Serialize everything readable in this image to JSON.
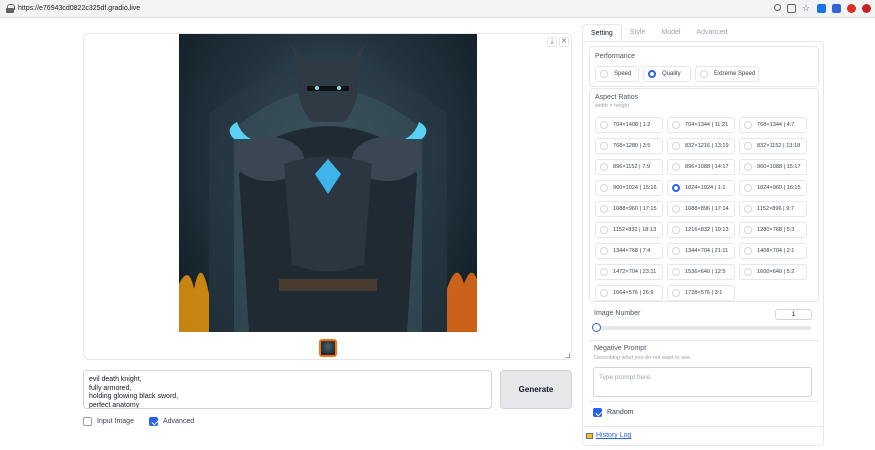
{
  "browser": {
    "url": "https://e76943cd0822c325df.gradio.live"
  },
  "gallery": {
    "image_alt": "evil death knight render",
    "selected_thumb": 0
  },
  "prompt": {
    "text": "evil death knight,\nfully armored,\nholding glowing black sword,\nperfect anatomy"
  },
  "generate_label": "Generate",
  "options": {
    "input_image_label": "Input Image",
    "input_image_checked": false,
    "advanced_label": "Advanced",
    "advanced_checked": true
  },
  "tabs": [
    "Setting",
    "Style",
    "Model",
    "Advanced"
  ],
  "performance": {
    "label": "Performance",
    "options": [
      "Speed",
      "Quality",
      "Extreme Speed"
    ],
    "selected": "Quality"
  },
  "aspect": {
    "label": "Aspect Ratios",
    "sub": "width × height",
    "options": [
      "704×1408 | 1:2",
      "704×1344 | 11:21",
      "768×1344 | 4:7",
      "768×1280 | 3:5",
      "832×1216 | 13:19",
      "832×1152 | 13:18",
      "896×1152 | 7:9",
      "896×1088 | 14:17",
      "960×1088 | 15:17",
      "960×1024 | 15:16",
      "1024×1024 | 1:1",
      "1024×960 | 16:15",
      "1088×960 | 17:15",
      "1088×896 | 17:14",
      "1152×896 | 9:7",
      "1152×832 | 18:13",
      "1216×832 | 19:13",
      "1280×768 | 5:3",
      "1344×768 | 7:4",
      "1344×704 | 21:11",
      "1408×704 | 2:1",
      "1472×704 | 23:11",
      "1536×640 | 12:5",
      "1600×640 | 5:2",
      "1664×576 | 26:9",
      "1728×576 | 3:1"
    ],
    "selected": "1024×1024 | 1:1"
  },
  "image_number": {
    "label": "Image Number",
    "value": "1",
    "fraction": 0.0
  },
  "negative": {
    "label": "Negative Prompt",
    "sub": "Describing what you do not want to see.",
    "placeholder": "Type prompt here."
  },
  "random": {
    "label": "Random",
    "checked": true
  },
  "history_label": "History Log",
  "colors": {
    "accent": "#2563eb",
    "thumb_border": "#f97316"
  }
}
